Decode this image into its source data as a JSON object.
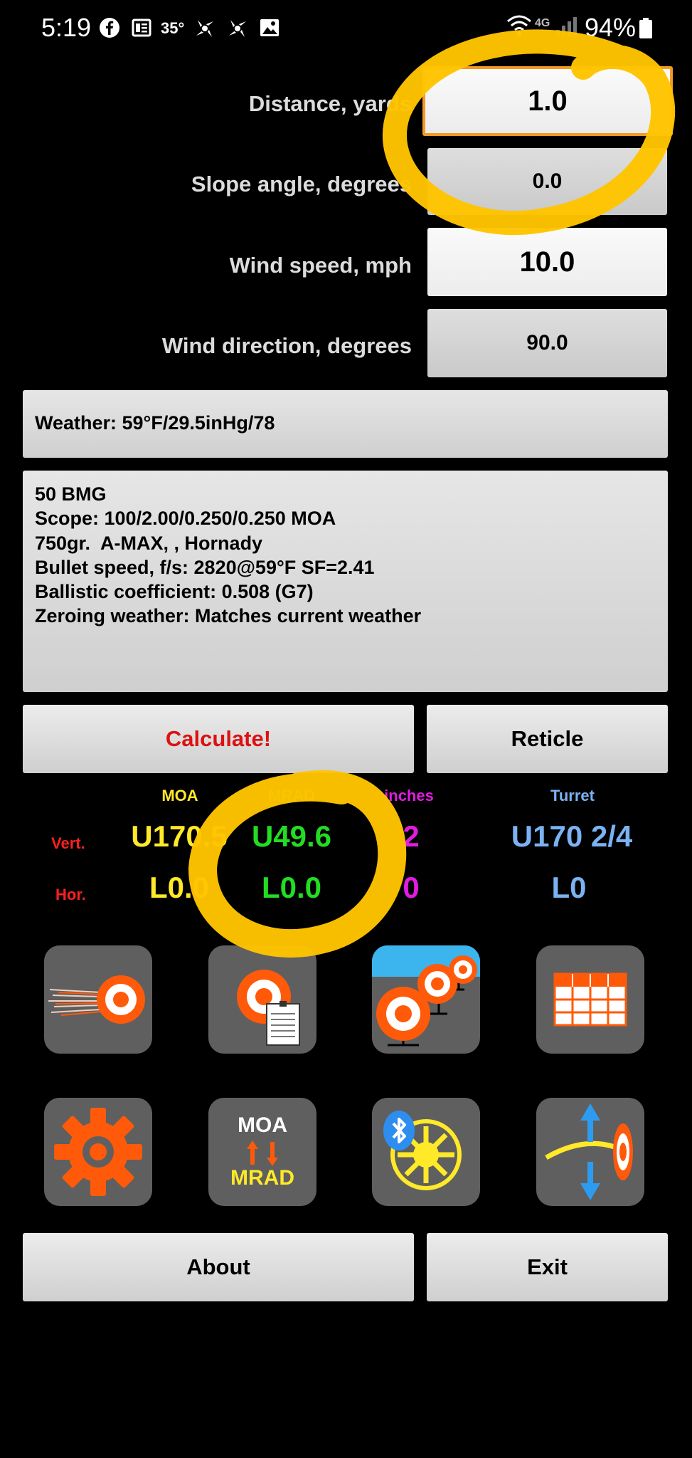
{
  "status": {
    "time": "5:19",
    "temperature": "35°",
    "network": "4G",
    "battery": "94%"
  },
  "inputs": {
    "distance": {
      "label": "Distance, yards",
      "value": "1.0"
    },
    "slope": {
      "label": "Slope angle, degrees",
      "value": "0.0"
    },
    "wind_speed": {
      "label": "Wind speed, mph",
      "value": "10.0"
    },
    "wind_direction": {
      "label": "Wind direction, degrees",
      "value": "90.0"
    }
  },
  "weather": "Weather: 59°F/29.5inHg/78",
  "profile": {
    "line1": "50 BMG",
    "line2": "Scope: 100/2.00/0.250/0.250 MOA",
    "line3": "750gr.  A-MAX, , Hornady",
    "line4": "Bullet speed, f/s: 2820@59°F SF=2.41",
    "line5": "Ballistic coefficient: 0.508 (G7)",
    "line6": "Zeroing weather: Matches current weather"
  },
  "buttons": {
    "calculate": "Calculate!",
    "reticle": "Reticle",
    "about": "About",
    "exit": "Exit"
  },
  "results": {
    "headers": {
      "moa": "MOA",
      "mrad": "MRAD",
      "inches": "inches",
      "turret": "Turret"
    },
    "row_labels": {
      "vert": "Vert.",
      "hor": "Hor."
    },
    "vert": {
      "moa": "U170.5",
      "mrad": "U49.6",
      "inches": "2",
      "turret": "U170 2/4"
    },
    "hor": {
      "moa": "L0.0",
      "mrad": "L0.0",
      "inches": "0",
      "turret": "L0"
    }
  },
  "tiles": {
    "units_top": "MOA",
    "units_bottom": "MRAD"
  },
  "colors": {
    "moa": "#ffe928",
    "mrad": "#22dd22",
    "inches": "#e21be2",
    "turret": "#7ab2f2",
    "calculate": "#dd1111",
    "rowlabel": "#ff1f1f",
    "annotation": "#ffc400",
    "tile_orange": "#ff5a0a"
  }
}
